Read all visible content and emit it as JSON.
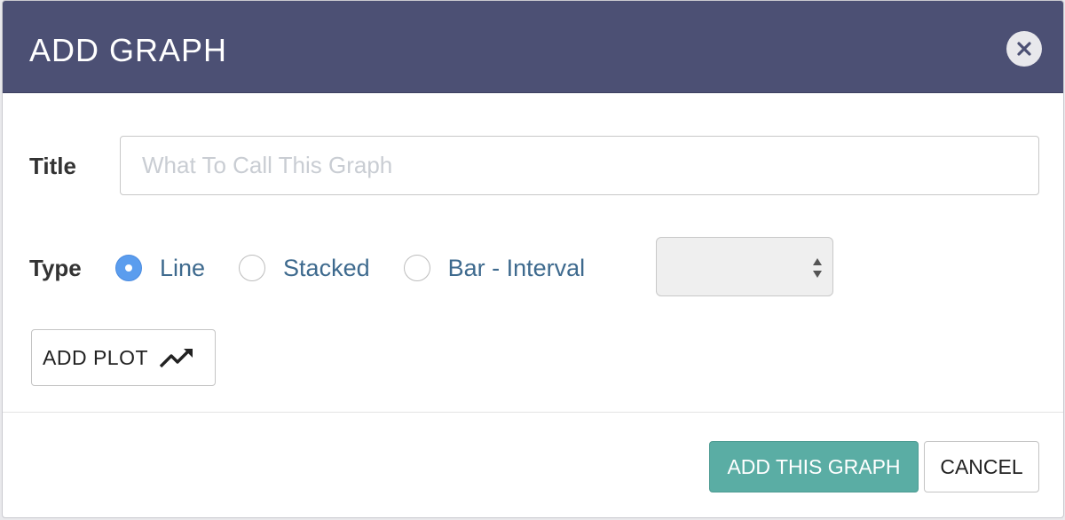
{
  "dialog": {
    "title": "ADD GRAPH",
    "close_icon": "close-icon"
  },
  "form": {
    "title_label": "Title",
    "title_value": "",
    "title_placeholder": "What To Call This Graph",
    "type_label": "Type",
    "type_options": [
      {
        "label": "Line",
        "checked": true
      },
      {
        "label": "Stacked",
        "checked": false
      },
      {
        "label": "Bar - Interval",
        "checked": false
      }
    ],
    "interval_select_value": "",
    "add_plot_label": "ADD PLOT",
    "add_plot_icon": "trending-up-icon"
  },
  "footer": {
    "submit_label": "ADD THIS GRAPH",
    "cancel_label": "CANCEL"
  },
  "colors": {
    "header": "#4c5074",
    "primary": "#5aada4",
    "radio_checked": "#5b9dee",
    "option_text": "#3e6a8e"
  }
}
